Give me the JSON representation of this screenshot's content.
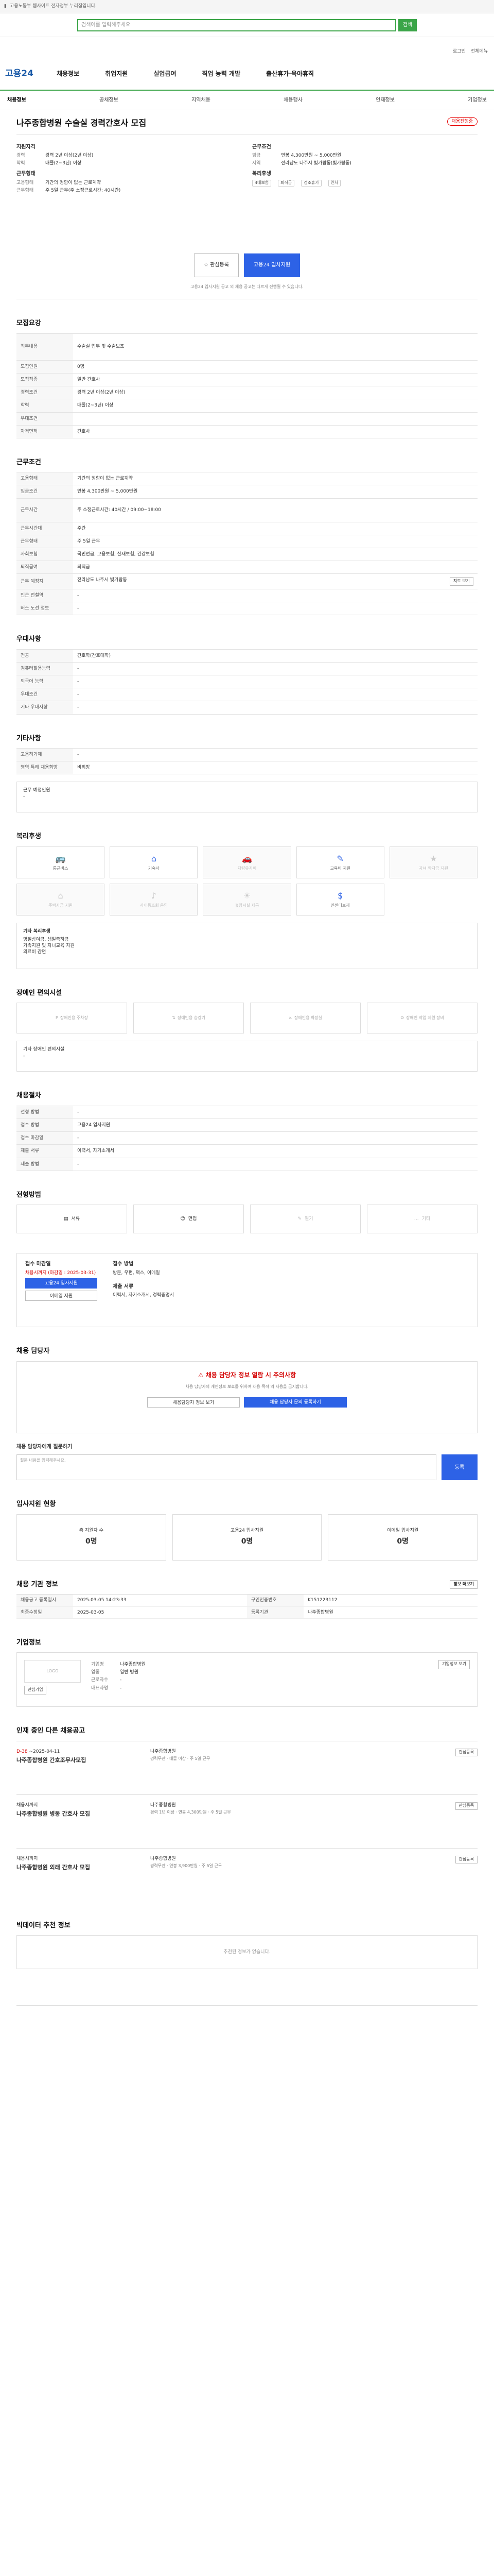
{
  "topbar": {
    "text": "고용노동부 웹사이트 전자정부 누리집입니다."
  },
  "search": {
    "placeholder": "검색어를 입력해주세요",
    "button": "검색"
  },
  "util": {
    "login": "로그인",
    "menu": "전체메뉴"
  },
  "gnb": {
    "logo": "고용24",
    "items": [
      "채용정보",
      "취업지원",
      "실업급여",
      "직업 능력 개발",
      "출산휴가·육아휴직"
    ]
  },
  "subnav": [
    "채용정보",
    "공채정보",
    "지역채용",
    "채용행사",
    "인재정보",
    "기업정보"
  ],
  "job": {
    "title": "나주종합병원 수술실 경력간호사 모집",
    "badge": "채용진행중",
    "left": {
      "h1": "지원자격",
      "rows": [
        [
          "경력",
          "경력 2년 이상(2년 이상)"
        ],
        [
          "학력",
          "대졸(2~3년) 이상"
        ]
      ],
      "h2": "근무형태",
      "rows2": [
        [
          "고용형태",
          "기간의 정함이 없는 근로계약"
        ],
        [
          "근무형태",
          "주 5일 근무(주 소정근로시간: 40시간)"
        ]
      ]
    },
    "right": {
      "h1": "근무조건",
      "rows": [
        [
          "임금",
          "연봉 4,300만원 ~ 5,000만원"
        ],
        [
          "지역",
          "전라남도 나주시 빛가람동(빛가람동)"
        ]
      ],
      "h2": "복리후생",
      "tags": [
        "4대보험",
        "퇴직금",
        "경조휴가",
        "연차"
      ]
    }
  },
  "actions": {
    "interest": "관심등록",
    "apply": "고용24 입사지원"
  },
  "notice": "고용24 입사지원 공고 외 채용 공고는 다르게 진행될 수 있습니다.",
  "sections": {
    "req": {
      "title": "모집요강",
      "rows": [
        [
          "직무내용",
          "수술실 업무 및 수술보조"
        ],
        [
          "모집인원",
          "0명"
        ],
        [
          "모집직종",
          "일반 간호사"
        ],
        [
          "경력조건",
          "경력 2년 이상(2년 이상)"
        ],
        [
          "학력",
          "대졸(2~3년) 이상"
        ],
        [
          "우대조건",
          ""
        ],
        [
          "자격면허",
          "간호사"
        ]
      ]
    },
    "cond": {
      "title": "근무조건",
      "rows": [
        [
          "고용형태",
          "기간의 정함이 없는 근로계약"
        ],
        [
          "임금조건",
          "연봉 4,300만원 ~ 5,000만원"
        ],
        [
          "근무시간",
          "주 소정근로시간: 40시간 / 09:00~18:00"
        ],
        [
          "근무시간대",
          "주간"
        ],
        [
          "근무형태",
          "주 5일 근무"
        ],
        [
          "사회보험",
          "국민연금, 고용보험, 산재보험, 건강보험"
        ],
        [
          "퇴직급여",
          "퇴직금"
        ],
        [
          "근무 예정지",
          "전라남도 나주시 빛가람동"
        ],
        [
          "인근 전철역",
          "-"
        ],
        [
          "버스 노선 정보",
          "-"
        ]
      ],
      "map_btn": "지도 보기"
    },
    "pref": {
      "title": "우대사항",
      "rows": [
        [
          "전공",
          "간호학(간호대학)"
        ],
        [
          "컴퓨터활용능력",
          "-"
        ],
        [
          "외국어 능력",
          "-"
        ],
        [
          "우대조건",
          "-"
        ],
        [
          "기타 우대사항",
          "-"
        ]
      ]
    },
    "etc": {
      "title": "기타사항",
      "rows": [
        [
          "고용허가제",
          "-"
        ],
        [
          "병역 특례 채용희망",
          "비희망"
        ]
      ],
      "box_title": "근무 예정인원",
      "box_val": "-"
    },
    "welfare": {
      "title": "복리후생",
      "items": [
        {
          "l": "통근버스",
          "on": true
        },
        {
          "l": "기숙사",
          "on": true
        },
        {
          "l": "차량유지비",
          "on": false
        },
        {
          "l": "교육비 지원",
          "on": true
        },
        {
          "l": "자녀 학자금 지원",
          "on": false
        },
        {
          "l": "주택자금 지원",
          "on": false
        },
        {
          "l": "사내동호회 운영",
          "on": false
        },
        {
          "l": "휴양시설 제공",
          "on": false
        },
        {
          "l": "인센티브제",
          "on": true
        }
      ],
      "etc_h": "기타 복리후생",
      "etc_v": "명절상여금, 생일축하금\n가족지원 및 자녀교육 지원\n의료비 감면"
    },
    "facility": {
      "title": "장애인 편의시설",
      "items": [
        "장애인용 주차장",
        "장애인용 승강기",
        "장애인용 화장실",
        "장애인 작업 지원 장비"
      ],
      "etc_h": "기타 장애인 편의시설",
      "etc_v": "-"
    },
    "screen": {
      "title": "채용절차",
      "rows": [
        [
          "전형 방법",
          "-"
        ],
        [
          "접수 방법",
          "고용24 입사지원"
        ],
        [
          "접수 마감일",
          "-"
        ],
        [
          "제출 서류",
          "이력서, 자기소개서"
        ],
        [
          "제출 방법",
          "-"
        ]
      ]
    },
    "method": {
      "title": "전형방법",
      "items": [
        {
          "l": "서류",
          "on": true
        },
        {
          "l": "면접",
          "on": true
        },
        {
          "l": "필기",
          "on": false
        },
        {
          "l": "기타",
          "on": false
        }
      ]
    },
    "apply": {
      "h1": "접수 마감일",
      "v1": "채용시까지 (마감일 : 2025-03-31)",
      "btn1": "고용24 입사지원",
      "btn2": "이메일 지원",
      "h2": "접수 방법",
      "v2": "방문, 우편, 팩스, 이메일",
      "h3": "제출 서류",
      "v3": "이력서, 자기소개서, 경력증명서"
    },
    "contact": {
      "title": "채용 담당자",
      "warn": "채용 담당자 정보 열람 시 주의사항",
      "desc": "채용 담당자의 개인정보 보호를 위하여 채용 목적 외 사용을 금지합니다.",
      "btn1": "채용담당자 정보 보기",
      "btn2": "채용 담당자 문의 등록하기",
      "q_h": "채용 담당자에게 질문하기",
      "q_ph": "질문 내용을 입력해주세요.",
      "q_btn": "등록"
    },
    "stats": {
      "title": "입사지원 현황",
      "items": [
        {
          "l": "총 지원자 수",
          "v": "0명"
        },
        {
          "l": "고용24 입사지원",
          "v": "0명"
        },
        {
          "l": "이메일 입사지원",
          "v": "0명"
        }
      ]
    },
    "info": {
      "title": "채용 기관 정보",
      "btn": "정보 더보기",
      "rows": [
        [
          "채용공고 등록일시",
          "2025-03-05 14:23:33",
          "구인인증번호",
          "K151223112"
        ],
        [
          "최종수정일",
          "2025-03-05",
          "등록기관",
          "나주종합병원"
        ]
      ]
    },
    "company": {
      "title": "기업정보",
      "logo": "LOGO",
      "btn1": "관심기업",
      "rows": [
        [
          "기업명",
          "나주종합병원"
        ],
        [
          "업종",
          "일반 병원"
        ],
        [
          "근로자수",
          "-"
        ],
        [
          "대표자명",
          "-"
        ]
      ],
      "btn2": "기업정보 보기"
    },
    "similar": {
      "title": "인재 중인 다른 채용공고",
      "items": [
        {
          "d": "D-38",
          "date": "~2025-04-11",
          "t": "나주종합병원 간호조무사모집",
          "c": "나주종합병원",
          "m": [
            "경력무관",
            "대졸 이상",
            "주 5일 근무"
          ]
        },
        {
          "d": "",
          "date": "채용시까지",
          "t": "나주종합병원 병동 간호사 모집",
          "c": "나주종합병원",
          "m": [
            "경력 1년 이상",
            "연봉 4,300만원",
            "주 5일 근무"
          ]
        },
        {
          "d": "",
          "date": "채용시까지",
          "t": "나주종합병원 외래 간호사 모집",
          "c": "나주종합병원",
          "m": [
            "경력무관",
            "연봉 3,900만원",
            "주 5일 근무"
          ]
        }
      ],
      "btn": "관심등록"
    },
    "recommend": {
      "title": "빅데이터 추천 정보",
      "empty": "추천된 정보가 없습니다."
    }
  }
}
